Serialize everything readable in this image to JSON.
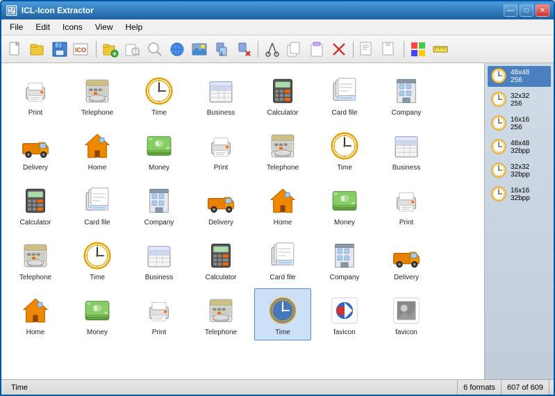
{
  "window": {
    "title": "ICL-Icon Extractor",
    "title_icon": "🖼",
    "controls": [
      "—",
      "□",
      "✕"
    ]
  },
  "menu": {
    "items": [
      "File",
      "Edit",
      "Icons",
      "View",
      "Help"
    ]
  },
  "toolbar": {
    "buttons": [
      {
        "icon": "📄",
        "name": "new"
      },
      {
        "icon": "📂",
        "name": "open"
      },
      {
        "icon": "💾",
        "name": "save"
      },
      {
        "icon": "🏷",
        "name": "ico"
      },
      "sep",
      {
        "icon": "📁➕",
        "name": "add-folder"
      },
      {
        "icon": "🔍",
        "name": "find-file"
      },
      {
        "icon": "🔎",
        "name": "search"
      },
      {
        "icon": "🌐",
        "name": "internet"
      },
      {
        "icon": "🖼",
        "name": "view"
      },
      {
        "icon": "📦",
        "name": "extract"
      },
      {
        "icon": "❌",
        "name": "remove"
      },
      "sep",
      {
        "icon": "✂",
        "name": "cut"
      },
      {
        "icon": "📋",
        "name": "copy"
      },
      {
        "icon": "📄",
        "name": "paste"
      },
      {
        "icon": "✕",
        "name": "delete"
      },
      "sep",
      {
        "icon": "🔒",
        "name": "lock1"
      },
      {
        "icon": "📄",
        "name": "doc"
      },
      "sep",
      {
        "icon": "🪟",
        "name": "windows"
      },
      {
        "icon": "📏",
        "name": "ruler"
      }
    ]
  },
  "icons": [
    {
      "label": "Print",
      "type": "printer"
    },
    {
      "label": "Telephone",
      "type": "telephone"
    },
    {
      "label": "Time",
      "type": "clock"
    },
    {
      "label": "Business",
      "type": "business"
    },
    {
      "label": "Calculator",
      "type": "calculator"
    },
    {
      "label": "Card file",
      "type": "cardfile"
    },
    {
      "label": "Company",
      "type": "company"
    },
    {
      "label": "Delivery",
      "type": "truck"
    },
    {
      "label": "Home",
      "type": "home"
    },
    {
      "label": "Money",
      "type": "money"
    },
    {
      "label": "Print",
      "type": "printer"
    },
    {
      "label": "Telephone",
      "type": "telephone"
    },
    {
      "label": "Time",
      "type": "clock"
    },
    {
      "label": "Business",
      "type": "business"
    },
    {
      "label": "Calculator",
      "type": "calculator"
    },
    {
      "label": "Card file",
      "type": "cardfile"
    },
    {
      "label": "Company",
      "type": "company"
    },
    {
      "label": "Delivery",
      "type": "truck"
    },
    {
      "label": "Home",
      "type": "home"
    },
    {
      "label": "Money",
      "type": "money"
    },
    {
      "label": "Print",
      "type": "printer"
    },
    {
      "label": "Telephone",
      "type": "telephone"
    },
    {
      "label": "Time",
      "type": "clock"
    },
    {
      "label": "Business",
      "type": "business"
    },
    {
      "label": "Calculator",
      "type": "calculator"
    },
    {
      "label": "Card file",
      "type": "cardfile"
    },
    {
      "label": "Company",
      "type": "company"
    },
    {
      "label": "Delivery",
      "type": "truck"
    },
    {
      "label": "Home",
      "type": "home"
    },
    {
      "label": "Money",
      "type": "money"
    },
    {
      "label": "Print",
      "type": "printer"
    },
    {
      "label": "Telephone",
      "type": "telephone"
    },
    {
      "label": "Time",
      "type": "clock",
      "selected": true
    },
    {
      "label": "favicon",
      "type": "favicon1"
    },
    {
      "label": "favicon",
      "type": "favicon2"
    }
  ],
  "formats": [
    {
      "size": "48x48",
      "bpp": "256",
      "selected": true
    },
    {
      "size": "32x32",
      "bpp": "256"
    },
    {
      "size": "16x16",
      "bpp": "256"
    },
    {
      "size": "48x48",
      "bpp": "32bpp"
    },
    {
      "size": "32x32",
      "bpp": "32bpp"
    },
    {
      "size": "16x16",
      "bpp": "32bpp"
    }
  ],
  "status": {
    "name": "Time",
    "formats": "6 formats",
    "count": "607 of 609"
  }
}
